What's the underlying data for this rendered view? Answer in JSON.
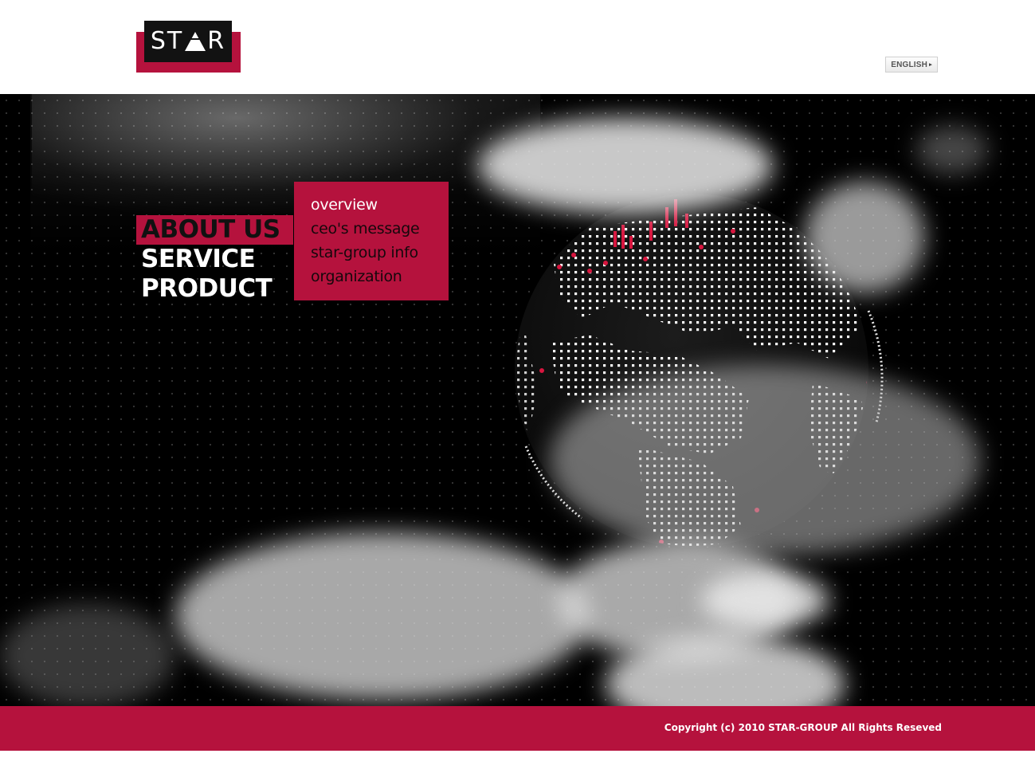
{
  "header": {
    "logo_text_left": "ST",
    "logo_text_right": "R",
    "language_button": "ENGLISH"
  },
  "nav": {
    "items": [
      {
        "label": "ABOUT US",
        "active": true
      },
      {
        "label": "SERVICE",
        "active": false
      },
      {
        "label": "PRODUCT",
        "active": false
      }
    ],
    "submenu": [
      {
        "label": "overview"
      },
      {
        "label": "ceo's message"
      },
      {
        "label": "star-group info"
      },
      {
        "label": "organization"
      }
    ]
  },
  "footer": {
    "copyright": "Copyright (c) 2010 STAR-GROUP All Rights Reseved"
  },
  "colors": {
    "brand": "#b5123d",
    "background": "#000000",
    "header": "#ffffff"
  },
  "icons": [
    "logo-triangle-icon",
    "chevron-right-icon",
    "globe-illustration"
  ]
}
